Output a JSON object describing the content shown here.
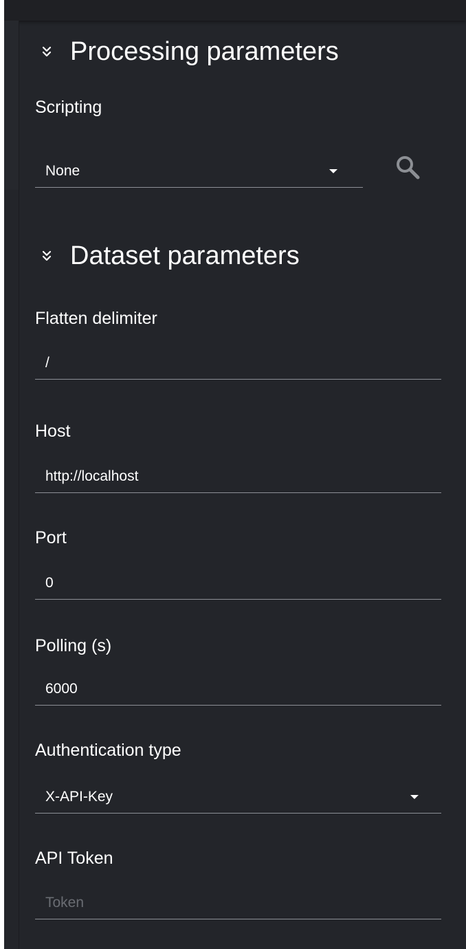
{
  "processing": {
    "title": "Processing parameters",
    "icon": "chevron-double-down-icon",
    "scripting": {
      "label": "Scripting",
      "value": "None",
      "search_icon": "search-icon"
    }
  },
  "dataset": {
    "title": "Dataset parameters",
    "icon": "chevron-double-down-icon",
    "flatten_delimiter": {
      "label": "Flatten delimiter",
      "value": "/"
    },
    "host": {
      "label": "Host",
      "value": "http://localhost"
    },
    "port": {
      "label": "Port",
      "value": "0"
    },
    "polling": {
      "label": "Polling (s)",
      "value": "6000"
    },
    "auth_type": {
      "label": "Authentication type",
      "value": "X-API-Key"
    },
    "api_token": {
      "label": "API Token",
      "value": "",
      "placeholder": "Token"
    }
  },
  "colors": {
    "panel_background": "#23252a",
    "text": "#ffffff",
    "underline": "#8d9096",
    "icon": "#8c8f94",
    "placeholder": "#6a6d73"
  }
}
